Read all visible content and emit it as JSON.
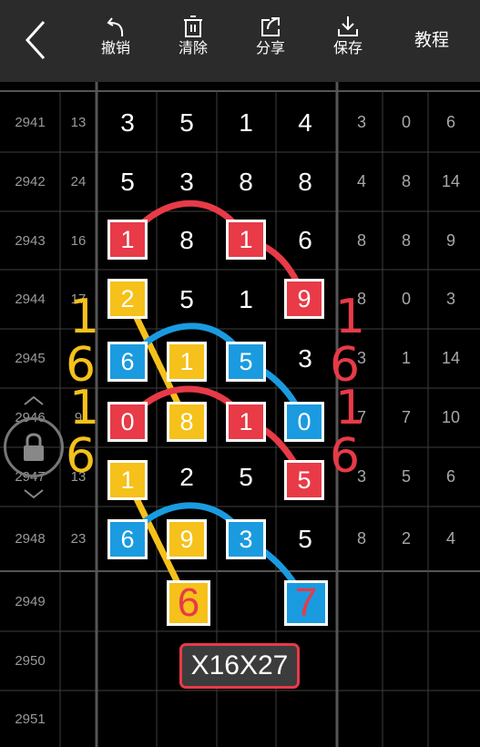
{
  "toolbar": {
    "undo_label": "撤销",
    "clear_label": "清除",
    "share_label": "分享",
    "save_label": "保存",
    "tutorial_label": "教程"
  },
  "rows": [
    {
      "index": "2941",
      "sum": "13",
      "digits": [
        "3",
        "5",
        "1",
        "4"
      ],
      "stats": [
        "3",
        "0",
        "6"
      ]
    },
    {
      "index": "2942",
      "sum": "24",
      "digits": [
        "5",
        "3",
        "8",
        "8"
      ],
      "stats": [
        "4",
        "8",
        "14"
      ]
    },
    {
      "index": "2943",
      "sum": "16",
      "digits": [
        "1",
        "8",
        "1",
        "6"
      ],
      "stats": [
        "8",
        "8",
        "9"
      ]
    },
    {
      "index": "2944",
      "sum": "17",
      "digits": [
        "2",
        "5",
        "1",
        "9"
      ],
      "stats": [
        "8",
        "0",
        "3"
      ]
    },
    {
      "index": "2945",
      "sum": "",
      "digits": [
        "6",
        "1",
        "5",
        "3"
      ],
      "stats": [
        "3",
        "1",
        "14"
      ]
    },
    {
      "index": "2946",
      "sum": "9",
      "digits": [
        "0",
        "8",
        "1",
        "0"
      ],
      "stats": [
        "7",
        "7",
        "10"
      ]
    },
    {
      "index": "2947",
      "sum": "13",
      "digits": [
        "1",
        "2",
        "5",
        "5"
      ],
      "stats": [
        "3",
        "5",
        "6"
      ]
    },
    {
      "index": "2948",
      "sum": "23",
      "digits": [
        "6",
        "9",
        "3",
        "5"
      ],
      "stats": [
        "8",
        "2",
        "4"
      ]
    },
    {
      "index": "2949",
      "sum": "",
      "digits": [
        "",
        "6",
        "",
        "7"
      ],
      "stats": [
        "",
        "",
        ""
      ]
    },
    {
      "index": "2950",
      "sum": "",
      "digits": [
        "",
        "",
        "",
        ""
      ],
      "stats": [
        "",
        "",
        ""
      ]
    },
    {
      "index": "2951",
      "sum": "",
      "digits": [
        "",
        "",
        "",
        ""
      ],
      "stats": [
        "",
        "",
        ""
      ]
    }
  ],
  "annotations": {
    "left_top_1": "1",
    "left_top_6": "6",
    "left_bot_1": "1",
    "left_bot_6": "6",
    "right_top_1": "1",
    "right_top_6": "6",
    "right_bot_1": "1",
    "right_bot_6": "6"
  },
  "formula": "X16X27",
  "colors": {
    "red": "#e83a47",
    "blue": "#1a9be0",
    "yellow": "#f5c11a",
    "grid_line": "#4a4a4a"
  }
}
